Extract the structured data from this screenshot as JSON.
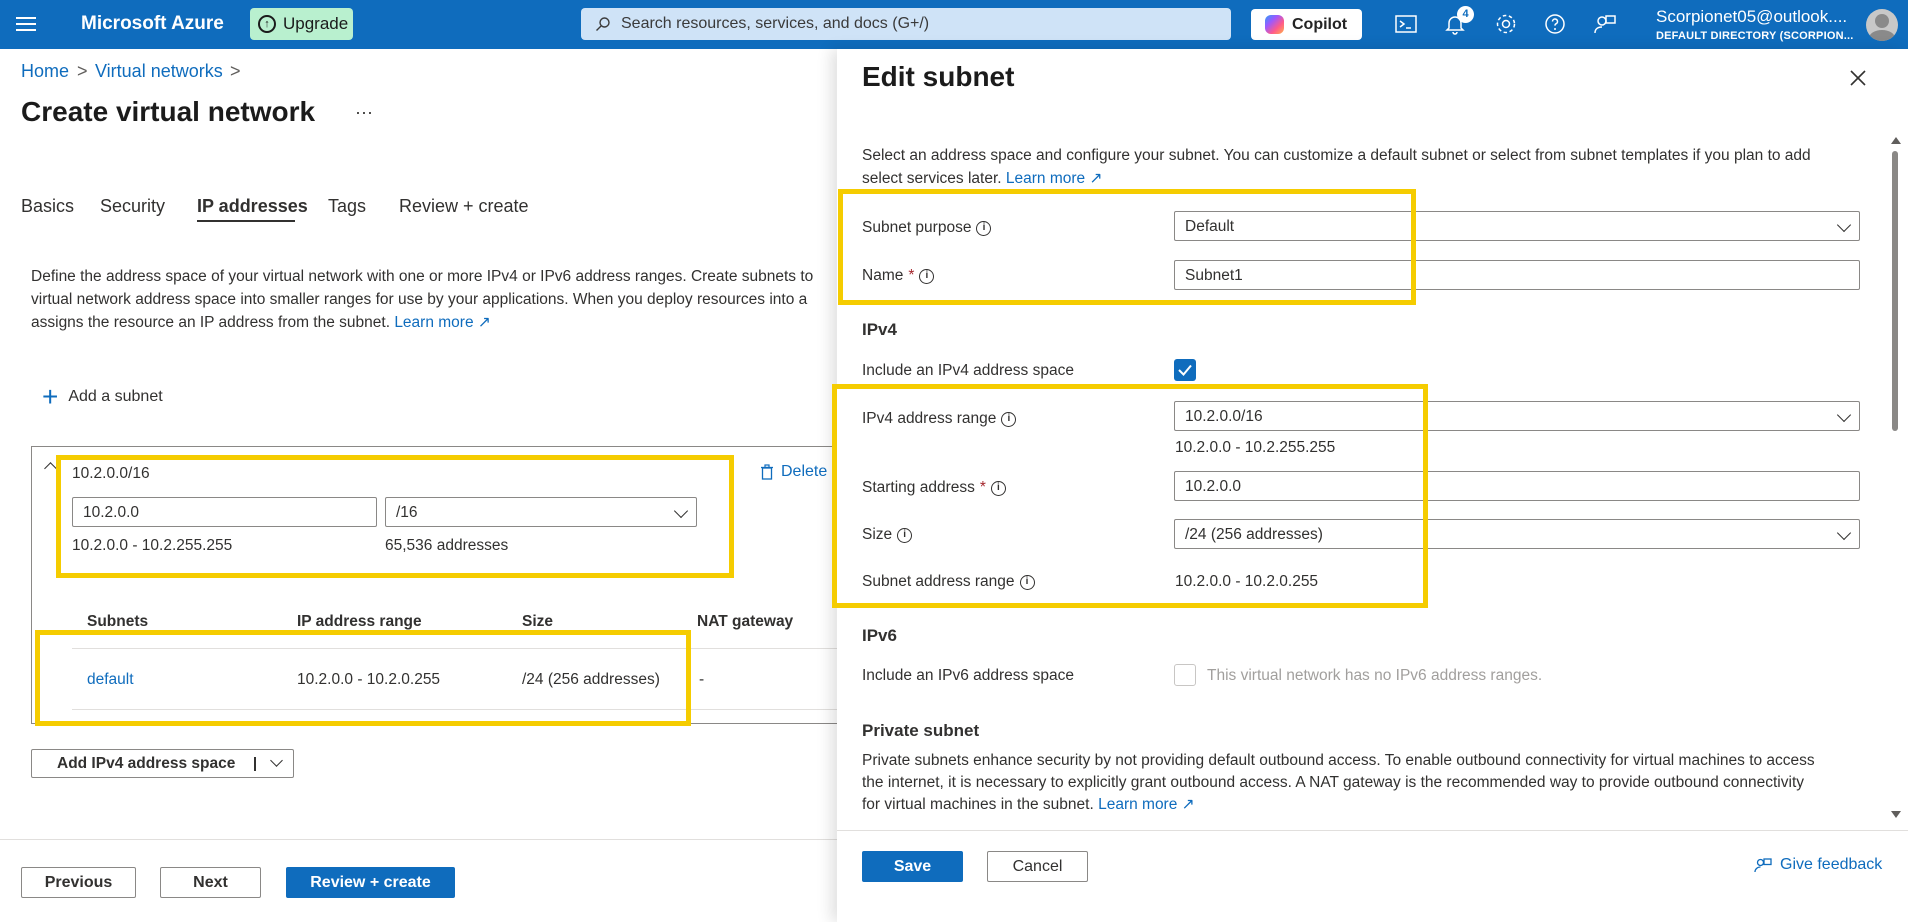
{
  "topbar": {
    "brand": "Microsoft Azure",
    "upgrade_label": "Upgrade",
    "search_placeholder": "Search resources, services, and docs (G+/)",
    "copilot_label": "Copilot",
    "notifications_count": "4",
    "account_name": "Scorpionet05@outlook....",
    "account_directory": "DEFAULT DIRECTORY (SCORPION..."
  },
  "breadcrumb": {
    "home": "Home",
    "sep1": ">",
    "virtual_networks": "Virtual networks",
    "sep2": ">"
  },
  "page": {
    "title": "Create virtual network",
    "more": "···"
  },
  "tabs": [
    {
      "label": "Basics"
    },
    {
      "label": "Security"
    },
    {
      "label": "IP addresses"
    },
    {
      "label": "Tags"
    },
    {
      "label": "Review + create"
    }
  ],
  "description": {
    "line1": "Define the address space of your virtual network with one or more IPv4 or IPv6 address ranges. Create subnets to",
    "line2": "virtual network address space into smaller ranges for use by your applications. When you deploy resources into a",
    "line3": "assigns the resource an IP address from the subnet.",
    "learn_more": "Learn more"
  },
  "add_subnet_label": "Add a subnet",
  "address_space": {
    "title": "10.2.0.0/16",
    "delete_label": "Delete",
    "start_value": "10.2.0.0",
    "prefix_value": "/16",
    "range_text": "10.2.0.0 - 10.2.255.255",
    "count_text": "65,536 addresses"
  },
  "subnet_table": {
    "headers": [
      "Subnets",
      "IP address range",
      "Size",
      "NAT gateway"
    ],
    "rows": [
      {
        "name": "default",
        "range": "10.2.0.0 - 10.2.0.255",
        "size": "/24 (256 addresses)",
        "nat": "-"
      }
    ]
  },
  "add_ipv4_label": "Add IPv4 address space",
  "footer": {
    "previous": "Previous",
    "next": "Next",
    "review": "Review + create"
  },
  "panel": {
    "title": "Edit subnet",
    "intro_line1": "Select an address space and configure your subnet. You can customize a default subnet or select from subnet templates if you plan to add",
    "intro_line2": "select services later.",
    "learn_more": "Learn more",
    "subnet_purpose_label": "Subnet purpose",
    "subnet_purpose_value": "Default",
    "name_label": "Name",
    "name_value": "Subnet1",
    "ipv4_heading": "IPv4",
    "include_ipv4_label": "Include an IPv4 address space",
    "ipv4_range_label": "IPv4 address range",
    "ipv4_range_value": "10.2.0.0/16",
    "ipv4_range_text": "10.2.0.0 - 10.2.255.255",
    "starting_address_label": "Starting address",
    "starting_address_value": "10.2.0.0",
    "size_label": "Size",
    "size_value": "/24 (256 addresses)",
    "subnet_range_label": "Subnet address range",
    "subnet_range_value": "10.2.0.0 - 10.2.0.255",
    "ipv6_heading": "IPv6",
    "include_ipv6_label": "Include an IPv6 address space",
    "ipv6_note": "This virtual network has no IPv6 address ranges.",
    "private_heading": "Private subnet",
    "private_line1": "Private subnets enhance security by not providing default outbound access. To enable outbound connectivity for virtual machines to access",
    "private_line2": "the internet, it is necessary to explicitly grant outbound access. A NAT gateway is the recommended way to provide outbound connectivity",
    "private_line3": "for virtual machines in the subnet.",
    "private_learn_more": "Learn more",
    "save": "Save",
    "cancel": "Cancel",
    "feedback": "Give feedback"
  },
  "colors": {
    "azure_blue": "#0f6cbd",
    "highlight": "#f5cc00",
    "upgrade_bg": "#b9f0cf"
  }
}
